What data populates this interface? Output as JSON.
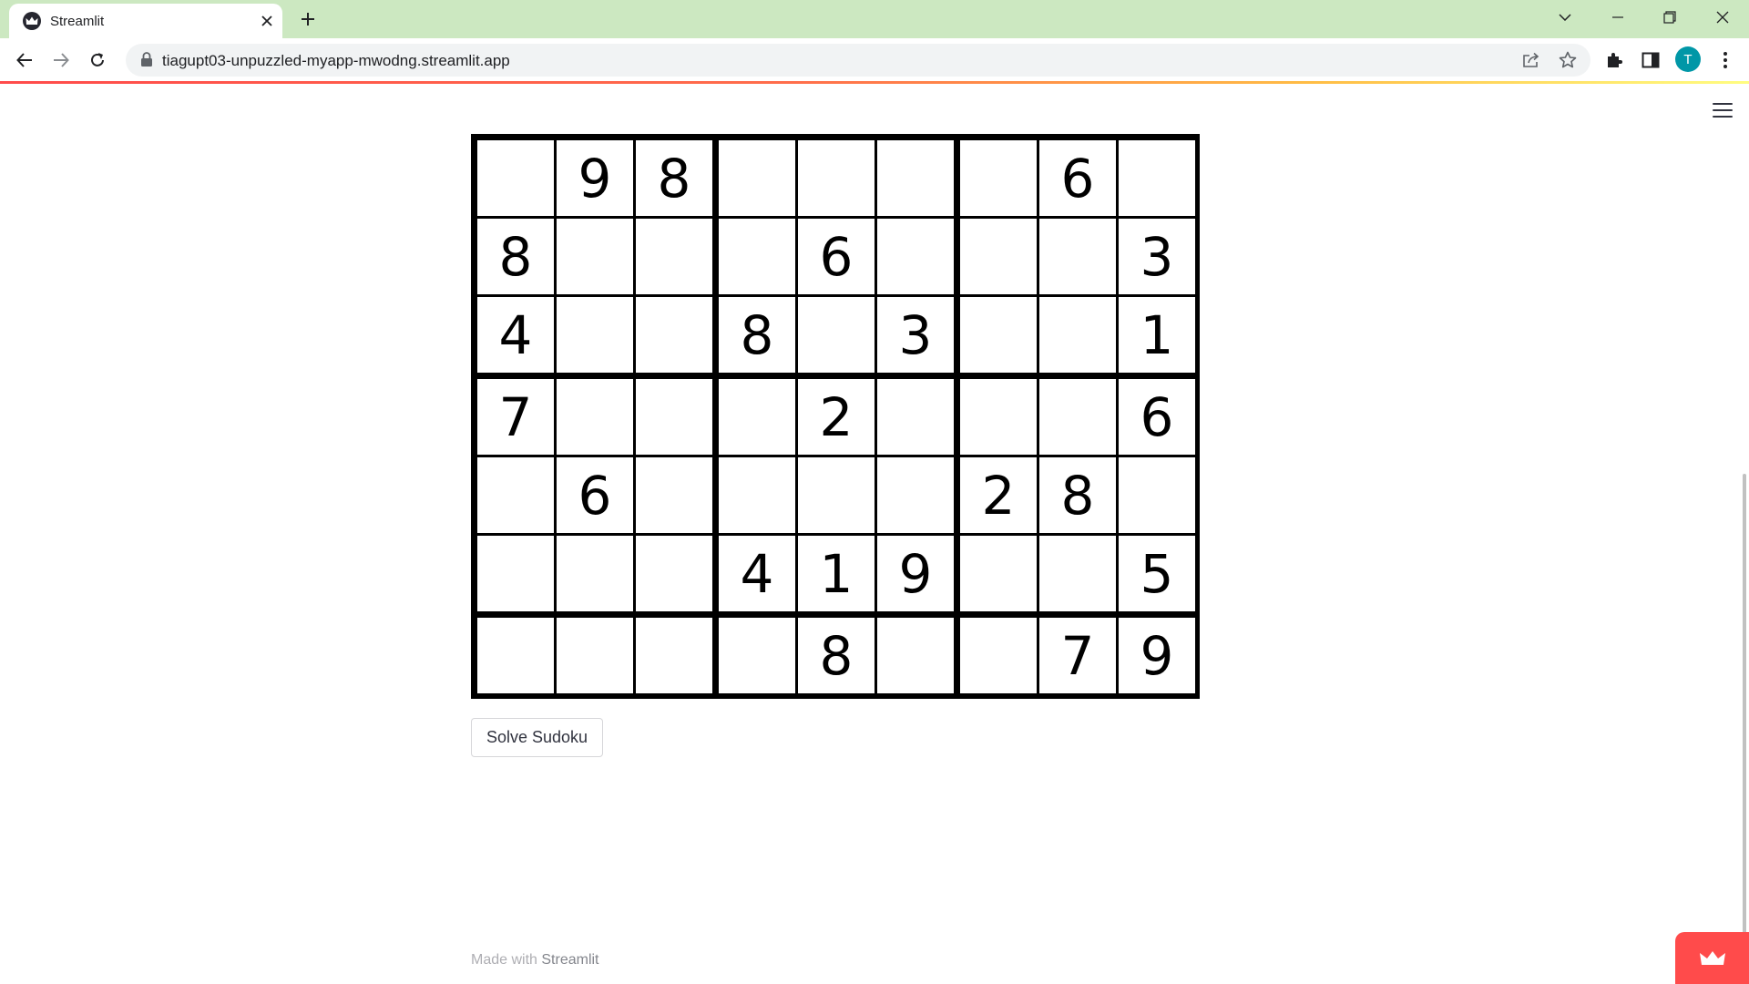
{
  "browser": {
    "tab_title": "Streamlit",
    "url": "tiagupt03-unpuzzled-myapp-mwodng.streamlit.app",
    "profile_initial": "T"
  },
  "colors": {
    "tabbar": "#cce8c1",
    "streamlit_red": "#ff4b4b",
    "avatar": "#0097a7"
  },
  "sudoku": {
    "rows": [
      [
        "",
        "9",
        "8",
        "",
        "",
        "",
        "",
        "6",
        ""
      ],
      [
        "8",
        "",
        "",
        "",
        "6",
        "",
        "",
        "",
        "3"
      ],
      [
        "4",
        "",
        "",
        "8",
        "",
        "3",
        "",
        "",
        "1"
      ],
      [
        "7",
        "",
        "",
        "",
        "2",
        "",
        "",
        "",
        "6"
      ],
      [
        "",
        "6",
        "",
        "",
        "",
        "",
        "2",
        "8",
        ""
      ],
      [
        "",
        "",
        "",
        "4",
        "1",
        "9",
        "",
        "",
        "5"
      ],
      [
        "",
        "",
        "",
        "",
        "8",
        "",
        "",
        "7",
        "9"
      ]
    ]
  },
  "solve_button": {
    "label": "Solve Sudoku"
  },
  "footer": {
    "prefix": "Made with",
    "link": "Streamlit"
  }
}
